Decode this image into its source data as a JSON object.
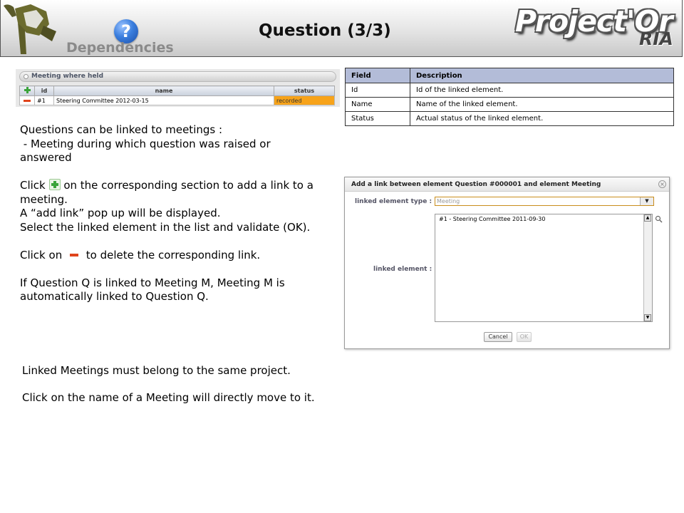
{
  "header": {
    "section_label": "Dependencies",
    "title": "Question (3/3)",
    "brand": "Project'Or",
    "brand_sub": "RIA",
    "help_icon_glyph": "?"
  },
  "meeting_widget": {
    "title": "Meeting where held",
    "columns": [
      "id",
      "name",
      "status"
    ],
    "rows": [
      {
        "id": "#1",
        "name": "Steering Committee 2012-03-15",
        "status": "recorded"
      }
    ]
  },
  "field_table": {
    "headers": [
      "Field",
      "Description"
    ],
    "rows": [
      {
        "field": "Id",
        "description": "Id of the linked element."
      },
      {
        "field": "Name",
        "description": "Name of the linked element."
      },
      {
        "field": "Status",
        "description": "Actual status of the linked element."
      }
    ]
  },
  "body": {
    "p1_line1": "Questions can be linked to meetings :",
    "p1_line2": " - Meeting during which question was raised or answered",
    "p2_pre": "Click",
    "p2_post": "on the corresponding section to add a link to a meeting.",
    "p3": "A “add link” pop up will be displayed.",
    "p4": "Select the linked element in the list and validate (OK).",
    "p5_pre": "Click on",
    "p5_post": "to delete the corresponding link.",
    "p6": "If Question Q is linked to Meeting M, Meeting M is automatically linked to Question Q."
  },
  "footer": {
    "line1": "Linked Meetings must belong to the same project.",
    "line2": "Click on the name of a Meeting will directly move to it."
  },
  "dialog": {
    "title": "Add a link between element Question #000001 and element Meeting",
    "type_label": "linked element type :",
    "type_value": "Meeting",
    "element_label": "linked element :",
    "list_items": [
      "#1 - Steering Committee 2011-09-30"
    ],
    "cancel_label": "Cancel",
    "ok_label": "OK"
  }
}
